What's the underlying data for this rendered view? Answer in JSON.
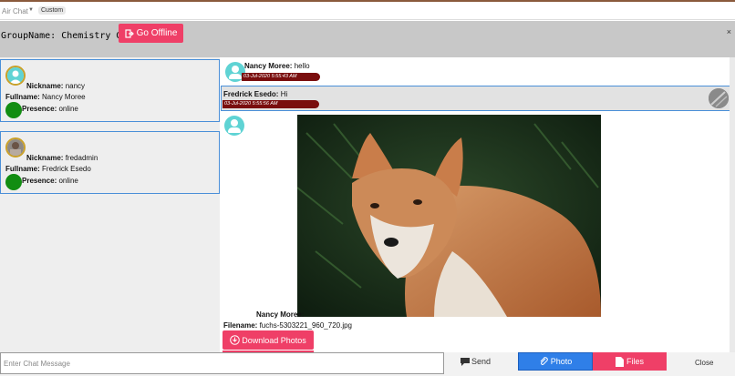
{
  "topbar": {
    "app_name": "Air Chat",
    "badge": "Custom"
  },
  "group": {
    "title": "GroupName: Chemistry Group",
    "offline_button": "Go Offline",
    "close": "×"
  },
  "members": [
    {
      "nickname_label": "Nickname:",
      "nickname": "nancy",
      "fullname_label": "Fullname:",
      "fullname": "Nancy Moree",
      "presence_label": "Presence:",
      "presence": "online"
    },
    {
      "nickname_label": "Nickname:",
      "nickname": "fredadmin",
      "fullname_label": "Fullname:",
      "fullname": "Fredrick Esedo",
      "presence_label": "Presence:",
      "presence": "online"
    }
  ],
  "messages": [
    {
      "sender": "Nancy Moree:",
      "text": "hello",
      "timestamp": "03-Jul-2020 5:55:43 AM"
    },
    {
      "sender": "Fredrick Esedo:",
      "text": "Hi",
      "timestamp": "03-Jul-2020 5:55:56 AM"
    }
  ],
  "photo_message": {
    "sender": "Nancy Moree:",
    "filename_label": "Filename:",
    "filename": "fuchs-5303221_960_720.jpg",
    "download_button": "Download Photos"
  },
  "composer": {
    "placeholder": "Enter Chat Message",
    "send": "Send",
    "photo": "Photo",
    "files": "Files",
    "close": "Close"
  },
  "colors": {
    "accent_pink": "#ef3f67",
    "accent_blue": "#2f7fe8",
    "timestamp_bg": "#7a0e0e",
    "presence_green": "#128d12"
  }
}
